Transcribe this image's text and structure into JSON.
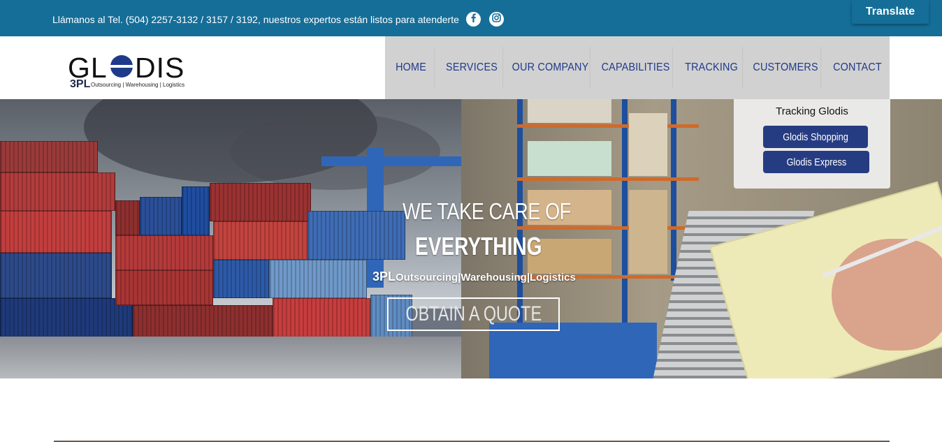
{
  "topbar": {
    "phone_text": "Llámanos al Tel. (504) 2257-3132 / 3157 / 3192, nuestros expertos están listos para atenderte",
    "social": [
      {
        "icon": "facebook-icon",
        "label": "f"
      },
      {
        "icon": "instagram-icon"
      }
    ],
    "translate_label": "Translate",
    "background": "#156e98"
  },
  "header": {
    "logo": {
      "word": "GLODIS",
      "prefix": "3PL",
      "tagline": "Outsourcing | Warehousing | Logistics"
    },
    "nav": [
      {
        "label": "HOME"
      },
      {
        "label": "SERVICES"
      },
      {
        "label": "OUR COMPANY"
      },
      {
        "label": "CAPABILITIES"
      },
      {
        "label": "TRACKING"
      },
      {
        "label": "CUSTOMERS"
      },
      {
        "label": "CONTACT"
      }
    ],
    "nav_color": "#1f3a8a",
    "nav_background": "#d1d1d1"
  },
  "hero": {
    "title_line1": "WE TAKE CARE OF",
    "title_line2": "EVERYTHING",
    "sub_prefix": "3PL",
    "sub_rest": "Outsourcing|Warehousing|Logistics",
    "cta_label": "OBTAIN A QUOTE"
  },
  "tracking_dropdown": {
    "title": "Tracking Glodis",
    "options": [
      {
        "label": "Glodis Shopping"
      },
      {
        "label": "Glodis Express"
      }
    ],
    "button_color": "#263c82"
  }
}
